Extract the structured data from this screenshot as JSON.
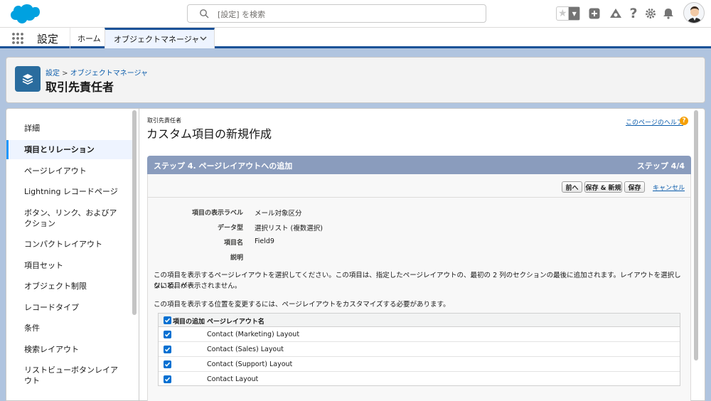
{
  "header": {
    "search_placeholder": "[設定] を検索",
    "icons": [
      "favorites-star-icon",
      "add-icon",
      "trailhead-icon",
      "help-icon",
      "setup-gear-icon",
      "notification-bell-icon"
    ]
  },
  "appnav": {
    "app_name": "設定",
    "home_tab": "ホーム",
    "object_manager_tab": "オブジェクトマネージャ"
  },
  "page_header": {
    "breadcrumb_setup": "設定",
    "breadcrumb_sep": " > ",
    "breadcrumb_objmgr": "オブジェクトマネージャ",
    "title": "取引先責任者"
  },
  "sidebar": {
    "items": [
      {
        "label": "詳細",
        "active": false
      },
      {
        "label": "項目とリレーション",
        "active": true
      },
      {
        "label": "ページレイアウト",
        "active": false
      },
      {
        "label": "Lightning レコードページ",
        "active": false
      },
      {
        "label": "ボタン、リンク、およびアクション",
        "active": false
      },
      {
        "label": "コンパクトレイアウト",
        "active": false
      },
      {
        "label": "項目セット",
        "active": false
      },
      {
        "label": "オブジェクト制限",
        "active": false
      },
      {
        "label": "レコードタイプ",
        "active": false
      },
      {
        "label": "条件",
        "active": false
      },
      {
        "label": "検索レイアウト",
        "active": false
      },
      {
        "label": "リストビューボタンレイアウト",
        "active": false
      }
    ]
  },
  "main": {
    "object_label": "取引先責任者",
    "title": "カスタム項目の新規作成",
    "help_link": "このページのヘルプ",
    "step_title": "ステップ 4. ページレイアウトへの追加",
    "step_num": "ステップ 4/4",
    "buttons": {
      "prev": "前へ",
      "save_new": "保存 & 新規",
      "save": "保存",
      "cancel": "キャンセル"
    },
    "fields": [
      {
        "label": "項目の表示ラベル",
        "value": "メール対象区分"
      },
      {
        "label": "データ型",
        "value": "選択リスト (複数選択)"
      },
      {
        "label": "項目名",
        "value": "Field9"
      },
      {
        "label": "説明",
        "value": ""
      }
    ],
    "desc1_line1": "この項目を表示するページレイアウトを選択してください。この項目は、指定したページレイアウトの、最初の 2 列のセクションの最後に追加されます。レイアウトを選択しないと、ペー",
    "desc1_line2": "ジに項目が表示されません。",
    "desc2": "この項目を表示する位置を変更するには、ページレイアウトをカスタマイズする必要があります。",
    "table": {
      "col_add": "項目の追加",
      "col_name": "ページレイアウト名",
      "rows": [
        {
          "name": "Contact (Marketing) Layout",
          "checked": true
        },
        {
          "name": "Contact (Sales) Layout",
          "checked": true
        },
        {
          "name": "Contact (Support) Layout",
          "checked": true
        },
        {
          "name": "Contact Layout",
          "checked": true
        }
      ]
    }
  }
}
